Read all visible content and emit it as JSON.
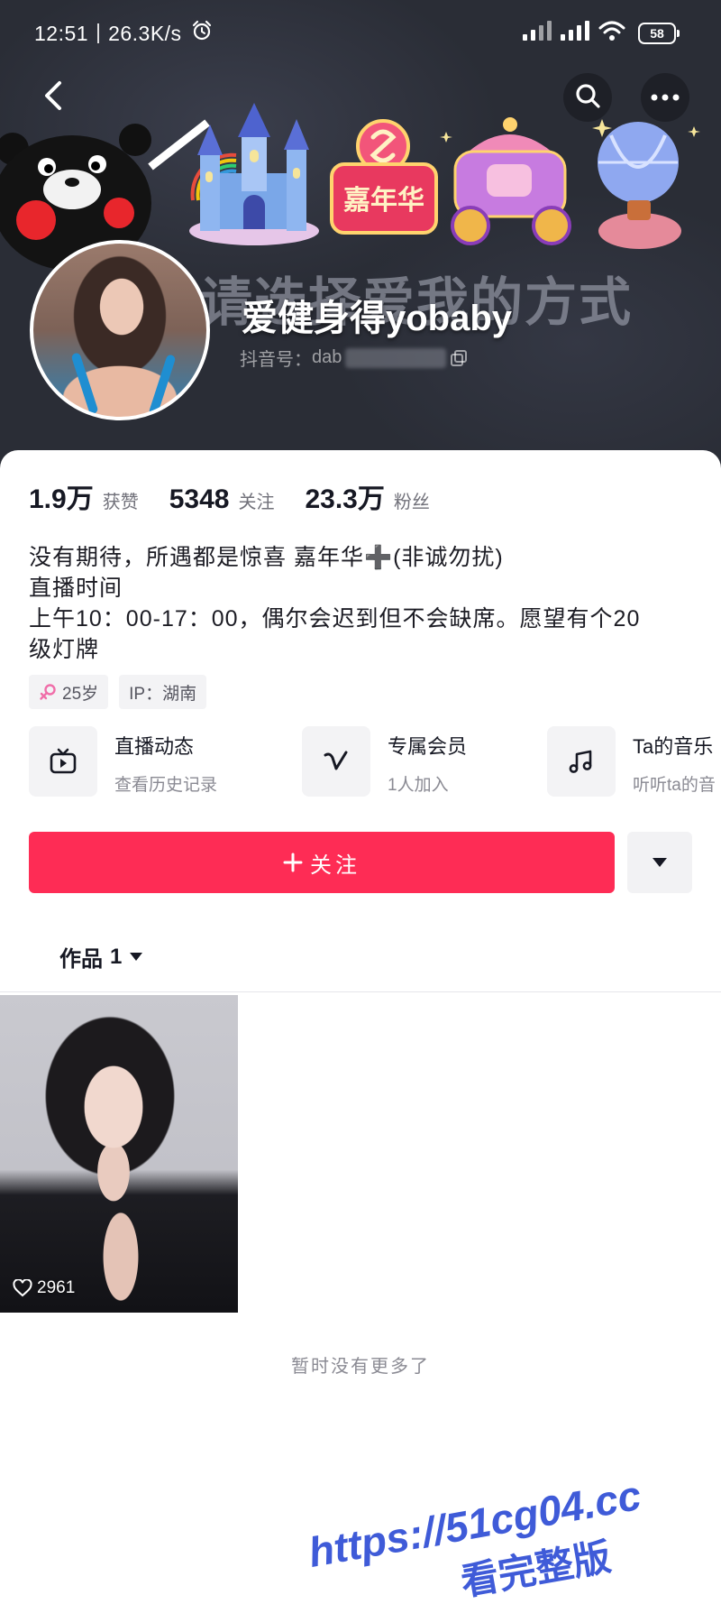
{
  "status_bar": {
    "time": "12:51",
    "net_speed": "26.3K/s",
    "battery_level": "58",
    "icons": [
      "alarm-clock-icon",
      "signal-bars-icon",
      "signal-bars-icon",
      "wifi-icon",
      "battery-icon"
    ]
  },
  "header": {
    "icons": {
      "back": "back-arrow-icon",
      "search": "search-icon",
      "more": "more-dots-icon"
    }
  },
  "banner": {
    "slogan": "请选择爱我的方式",
    "badge": "嘉年华"
  },
  "profile": {
    "name": "爱健身得yobaby",
    "id_label": "抖音号：",
    "id_value": "dab",
    "copy_icon": "copy-icon"
  },
  "stats": [
    {
      "value": "1.9万",
      "label": "获赞"
    },
    {
      "value": "5348",
      "label": "关注"
    },
    {
      "value": "23.3万",
      "label": "粉丝"
    }
  ],
  "bio": [
    "没有期待，所遇都是惊喜 嘉年华➕(非诚勿扰)",
    "直播时间",
    "上午10：00-17：00，偶尔会迟到但不会缺席。愿望有个20",
    "级灯牌"
  ],
  "tags": [
    {
      "icon": "female-icon",
      "text": "25岁"
    },
    {
      "text": "IP：湖南"
    }
  ],
  "features": [
    {
      "icon": "tv-icon",
      "title": "直播动态",
      "subtitle": "查看历史记录"
    },
    {
      "icon": "v-icon",
      "title": "专属会员",
      "subtitle": "1人加入"
    },
    {
      "icon": "music-note-icon",
      "title": "Ta的音乐",
      "subtitle": "听听ta的音"
    }
  ],
  "follow_button": {
    "icon": "plus-icon",
    "label": "关注"
  },
  "more_button": {
    "icon": "caret-down-icon"
  },
  "works_tab": {
    "label": "作品",
    "count": "1",
    "icon": "caret-down-icon"
  },
  "videos": [
    {
      "likes": "2961",
      "icon": "heart-outline-icon"
    }
  ],
  "empty_text": "暂时没有更多了",
  "watermark": {
    "line1": "https://51cg04.cc",
    "line2": "看完整版"
  },
  "colors": {
    "accent": "#fe2c55",
    "header_bg": "#2a2d36",
    "card_bg": "#ffffff",
    "watermark": "#3f5bd8",
    "female_tag": "#f06ea9"
  }
}
